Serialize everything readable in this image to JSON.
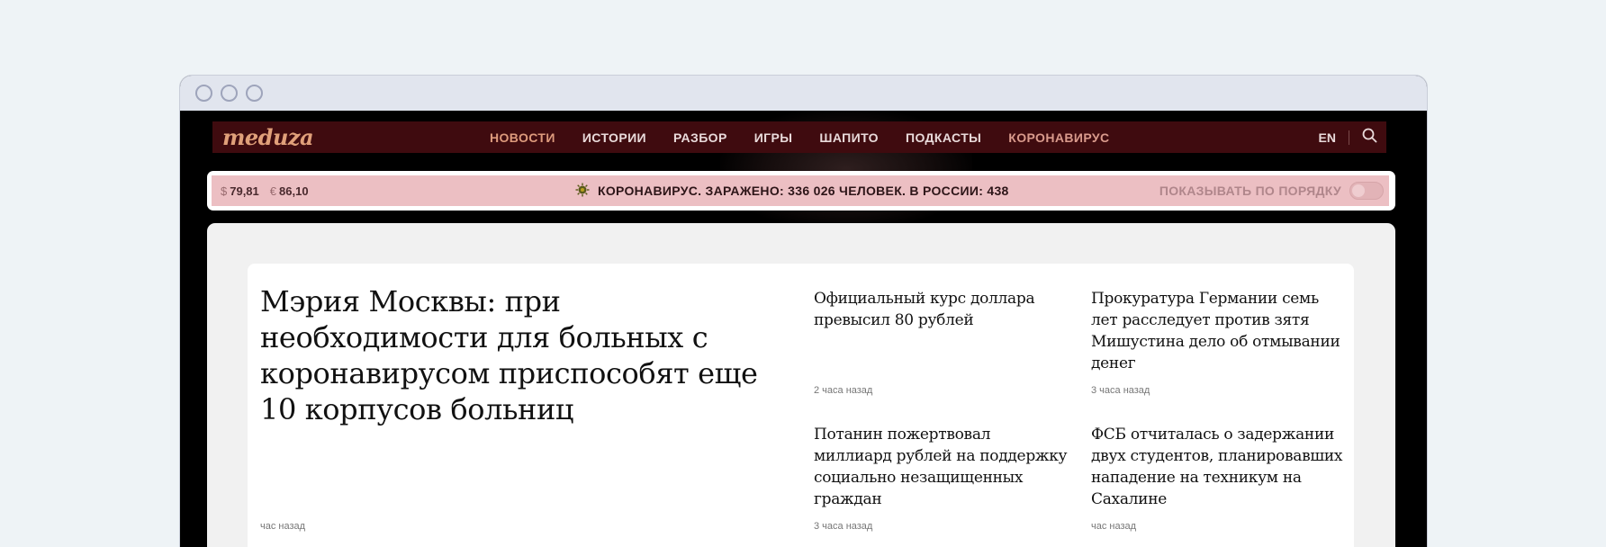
{
  "window": {
    "controls": [
      "circle",
      "circle",
      "circle"
    ]
  },
  "nav": {
    "logo": "meduza",
    "items": [
      {
        "label": "НОВОСТИ",
        "state": "active"
      },
      {
        "label": "ИСТОРИИ",
        "state": "normal"
      },
      {
        "label": "РАЗБОР",
        "state": "normal"
      },
      {
        "label": "ИГРЫ",
        "state": "normal"
      },
      {
        "label": "ШАПИТО",
        "state": "normal"
      },
      {
        "label": "ПОДКАСТЫ",
        "state": "normal"
      },
      {
        "label": "КОРОНАВИРУС",
        "state": "accent"
      }
    ],
    "lang": "EN",
    "search_icon": "search-icon"
  },
  "ticker": {
    "usd_symbol": "$",
    "usd_value": "79,81",
    "eur_symbol": "€",
    "eur_value": "86,10",
    "corona_text": "КОРОНАВИРУС. ЗАРАЖЕНО: 336 026 ЧЕЛОВЕК. В РОССИИ: 438",
    "order_label": "ПОКАЗЫВАТЬ ПО ПОРЯДКУ",
    "order_enabled": false
  },
  "main_story": {
    "title": "Мэрия Москвы: при необходимости для больных с коронавирусом приспособят еще 10 корпусов больниц",
    "time": "час назад"
  },
  "stories": [
    {
      "title": "Официальный курс доллара превысил 80 рублей",
      "time": "2 часа назад"
    },
    {
      "title": "Прокуратура Германии семь лет расследует против зятя Мишустина дело об отмывании денег",
      "time": "3 часа назад"
    },
    {
      "title": "Потанин пожертвовал миллиард рублей на поддержку социально незащищенных граждан",
      "time": "3 часа назад"
    },
    {
      "title": "ФСБ отчиталась о задержании двух студентов, планировавших нападение на техникум на Сахалине",
      "time": "час назад"
    }
  ],
  "colors": {
    "nav_bg": "#3f0b0f",
    "ticker_bg": "#ecbfc3",
    "active_nav": "#dd9a7c"
  }
}
